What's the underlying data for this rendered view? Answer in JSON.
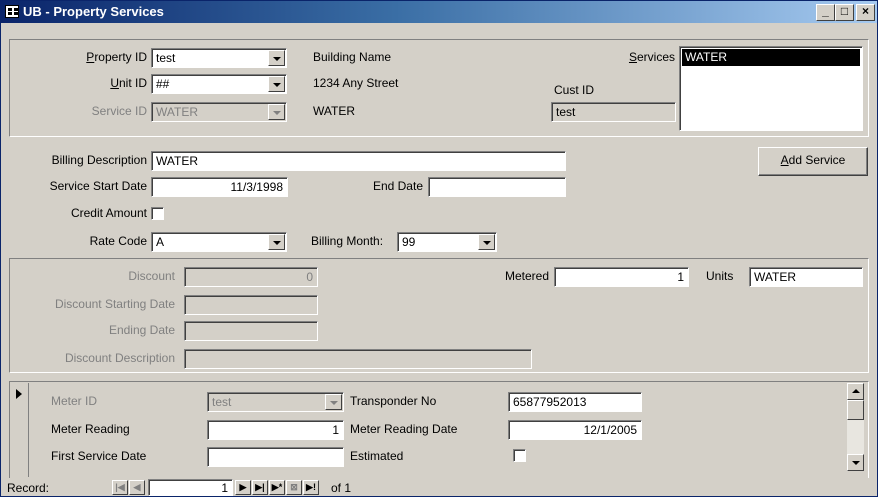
{
  "window": {
    "title": "UB - Property Services",
    "minimize": "_",
    "restore": "□",
    "close": "×"
  },
  "header": {
    "property_id_label": "Property ID",
    "property_id_value": "test",
    "unit_id_label": "Unit ID",
    "unit_id_value": "##",
    "service_id_label": "Service ID",
    "service_id_value": "WATER",
    "building_name": "Building Name",
    "address": "1234 Any Street",
    "service_name": "WATER",
    "services_label": "Services",
    "services_items": [
      "WATER"
    ],
    "cust_id_label": "Cust ID",
    "cust_id_value": "test"
  },
  "billing": {
    "description_label": "Billing Description",
    "description_value": "WATER",
    "start_date_label": "Service Start Date",
    "start_date_value": "11/3/1998",
    "end_date_label": "End Date",
    "end_date_value": "",
    "credit_label": "Credit Amount",
    "rate_code_label": "Rate Code",
    "rate_code_value": "A",
    "billing_month_label": "Billing Month:",
    "billing_month_value": "99",
    "add_service_label": "Add Service"
  },
  "discount": {
    "discount_label": "Discount",
    "discount_value": "0",
    "start_label": "Discount Starting Date",
    "start_value": "",
    "ending_label": "Ending Date",
    "ending_value": "",
    "desc_label": "Discount Description",
    "desc_value": "",
    "metered_label": "Metered",
    "metered_value": "1",
    "units_label": "Units",
    "units_value": "WATER"
  },
  "meter": {
    "meter_id_label": "Meter ID",
    "meter_id_value": "test",
    "transponder_label": "Transponder No",
    "transponder_value": "65877952013",
    "reading_label": "Meter Reading",
    "reading_value": "1",
    "reading_date_label": "Meter Reading Date",
    "reading_date_value": "12/1/2005",
    "first_service_label": "First Service Date",
    "first_service_value": "",
    "estimated_label": "Estimated"
  },
  "record_nav": {
    "label": "Record:",
    "current": "1",
    "of_text": "of 1"
  }
}
